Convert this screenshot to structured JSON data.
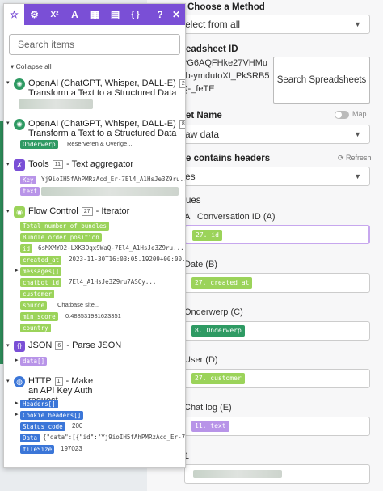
{
  "toolbar": {
    "icons": [
      "star-icon",
      "gear-icon",
      "superscript-icon",
      "font-icon",
      "calendar-icon",
      "table-icon",
      "braces-icon",
      "help-icon",
      "close-icon"
    ],
    "labels": [
      "☆",
      "⚙",
      "X²",
      "A",
      "▦",
      "▤",
      "{ }",
      "?",
      "✕"
    ]
  },
  "search": {
    "placeholder": "Search items",
    "value": ""
  },
  "collapse_label": "Collapse all",
  "modules": [
    {
      "title": "OpenAI (ChatGPT, Whisper, DALL-E)",
      "badge": "23",
      "subtitle": "Transform a Text to a Structured Data"
    },
    {
      "title": "OpenAI (ChatGPT, Whisper, DALL-E)",
      "badge": "8",
      "subtitle": "Transform a Text to a Structured Data",
      "items": [
        {
          "tag": "Onderwerp",
          "value": "Reserveren & Overige..."
        }
      ]
    },
    {
      "title": "Tools",
      "badge": "11",
      "subtitle": "Text aggregator",
      "items": [
        {
          "tag": "Key",
          "value": "Yj9ioIH5fAhPMRzAcd_Er-7El4_A1HsJe3Z9ru..."
        },
        {
          "tag": "text",
          "value": ""
        }
      ]
    },
    {
      "title": "Flow Control",
      "badge": "27",
      "subtitle": "Iterator",
      "items": [
        {
          "tag": "Total number of bundles",
          "value": ""
        },
        {
          "tag": "Bundle order position",
          "value": ""
        },
        {
          "tag": "id",
          "value": "6sMXMYD2-LXK3Oqx9WaQ-7El4_A1HsJe3Z9ru..."
        },
        {
          "tag": "created_at",
          "value": "2023-11-30T16:03:05.19209+00:00..."
        },
        {
          "tag": "messages[]",
          "value": ""
        },
        {
          "tag": "chatbot_id",
          "value": "7El4_A1HsJe3Z9ru7ASCy..."
        },
        {
          "tag": "customer",
          "value": ""
        },
        {
          "tag": "source",
          "value": "Chatbase site..."
        },
        {
          "tag": "min_score",
          "value": "0.488531931623351"
        },
        {
          "tag": "country",
          "value": ""
        }
      ]
    },
    {
      "title": "JSON",
      "badge": "6",
      "subtitle": "Parse JSON",
      "items": [
        {
          "tag": "data[]",
          "value": ""
        }
      ]
    },
    {
      "title": "HTTP",
      "badge": "1",
      "subtitle": "Make an API Key Auth request",
      "items": [
        {
          "tag": "Headers[]",
          "value": ""
        },
        {
          "tag": "Cookie headers[]",
          "value": ""
        },
        {
          "tag": "Status code",
          "value": "200"
        },
        {
          "tag": "Data",
          "value": "{\"data\":[{\"id\":\"Yj9ioIH5fAhPMRzAcd_Er-7El4_A1..."
        },
        {
          "tag": "fileSize",
          "value": "197023"
        }
      ]
    }
  ],
  "right_panel": {
    "method_label": "Choose a Method",
    "method_value": "elect from all",
    "sheet_id_label": "eadsheet ID",
    "sheet_id_value": "PG6AQFHke27VHMu\nsb-ymdutoXI_PkSRB5\nQ-_feTE",
    "search_spreadsheets": "Search Spreadsheets",
    "sheet_name_label": "et Name",
    "map_label": "Map",
    "sheet_name_value": "aw data",
    "headers_label": "e contains headers",
    "refresh_label": "Refresh",
    "headers_value": "es",
    "values_label": "ues",
    "fields": [
      {
        "label": "A   Conversation ID (A)",
        "pill": "27. id"
      },
      {
        "label": "Date (B)",
        "pill": "27. created at"
      },
      {
        "label": "Onderwerp (C)",
        "pill": "8. Onderwerp"
      },
      {
        "label": "User (D)",
        "pill": "27. customer"
      },
      {
        "label": "Chat log (E)",
        "pill": "11. text"
      }
    ],
    "last_field_label": "1"
  }
}
